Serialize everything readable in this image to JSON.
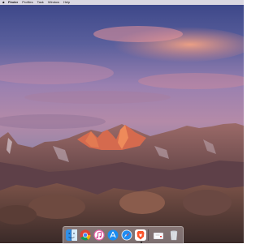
{
  "menubar": {
    "items": [
      "Finder",
      "Profiles",
      "Task",
      "Window",
      "Help"
    ]
  },
  "desktop": {
    "wallpaper": "macOS Sierra mountain at sunset"
  },
  "dock": {
    "apps": [
      {
        "name": "Finder",
        "icon": "finder-icon"
      },
      {
        "name": "Chrome",
        "icon": "chrome-icon"
      },
      {
        "name": "iTunes",
        "icon": "itunes-icon"
      },
      {
        "name": "App Store",
        "icon": "app-store-icon"
      },
      {
        "name": "Safari",
        "icon": "safari-icon"
      },
      {
        "name": "Brave",
        "icon": "brave-icon"
      }
    ],
    "trailing": [
      {
        "name": "Documents",
        "icon": "folder-icon"
      },
      {
        "name": "Trash",
        "icon": "trash-icon"
      }
    ]
  },
  "colors": {
    "sky_top": "#3d4a8a",
    "sky_mid": "#a779a8",
    "clouds": "#ef9a7e",
    "peak_glow": "#d9623f",
    "rock": "#7a4f45"
  }
}
